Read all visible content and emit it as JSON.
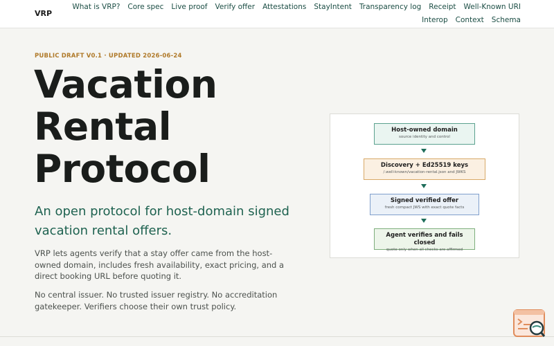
{
  "header": {
    "logo": "VRP",
    "nav": [
      "What is VRP?",
      "Core spec",
      "Live proof",
      "Verify offer",
      "Attestations",
      "StayIntent",
      "Transparency log",
      "Receipt",
      "Well-Known URI",
      "Interop",
      "Context",
      "Schema"
    ]
  },
  "hero": {
    "eyebrow": "PUBLIC DRAFT V0.1 · UPDATED 2026-06-24",
    "title": "Vacation Rental Protocol",
    "lead": "An open protocol for host-domain signed vacation rental offers.",
    "body1": "VRP lets agents verify that a stay offer came from the host-owned domain, includes fresh availability, exact pricing, and a direct booking URL before quoting it.",
    "body2": "No central issuer. No trusted issuer registry. No accreditation gatekeeper. Verifiers choose their own trust policy."
  },
  "diagram": {
    "steps": [
      {
        "title": "Host-owned domain",
        "sub": "source identity and control"
      },
      {
        "title": "Discovery + Ed25519 keys",
        "sub": "/.well-known/vacation-rental.json and JWKS"
      },
      {
        "title": "Signed verified offer",
        "sub": "fresh compact JWS with exact quote facts"
      },
      {
        "title": "Agent verifies and fails closed",
        "sub": "quote only when all checks are affirmed"
      }
    ]
  },
  "widget": {
    "icon": "search-document-icon"
  },
  "colors": {
    "accent": "#1e6250",
    "eyebrow": "#b07a2a",
    "nav_link": "#1b4d44",
    "background": "#f5f5f2"
  }
}
